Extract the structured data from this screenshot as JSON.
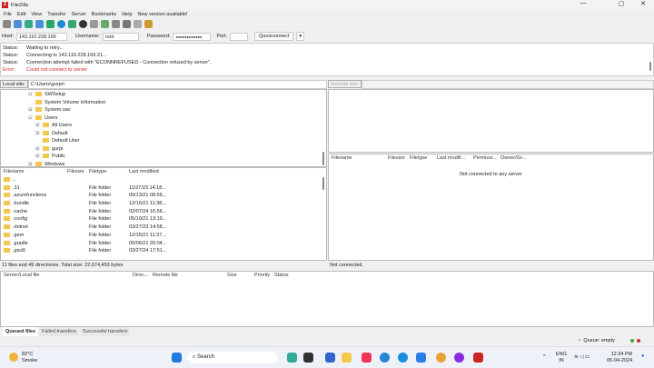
{
  "window": {
    "title": "FileZilla",
    "minimize": "—",
    "maximize": "▢",
    "close": "✕"
  },
  "menu": [
    "File",
    "Edit",
    "View",
    "Transfer",
    "Server",
    "Bookmarks",
    "Help",
    "New version available!"
  ],
  "toolbar_icons": [
    "site-manager",
    "toggle-log",
    "toggle-local-tree",
    "toggle-remote-tree",
    "toggle-queue",
    "refresh",
    "process-queue",
    "cancel",
    "disconnect",
    "reconnect",
    "directory-filter",
    "compare",
    "sync-browse",
    "find"
  ],
  "quickconnect": {
    "host_label": "Host:",
    "host": "143.110.228.169",
    "username_label": "Username:",
    "username": "root",
    "password_label": "Password:",
    "password": "●●●●●●●●●●●●",
    "port_label": "Port:",
    "port": "",
    "button": "Quickconnect",
    "dropdown": "▾"
  },
  "log": [
    {
      "k": "Status:",
      "v": "Waiting to retry...",
      "type": "status"
    },
    {
      "k": "Status:",
      "v": "Connecting to 143.110.228.169:21...",
      "type": "status"
    },
    {
      "k": "Status:",
      "v": "Connection attempt failed with \"ECONNREFUSED - Connection refused by server\".",
      "type": "status"
    },
    {
      "k": "Error:",
      "v": "Could not connect to server",
      "type": "error"
    }
  ],
  "local": {
    "site_label": "Local site:",
    "path": "C:\\Users\\gurpr\\",
    "tree": [
      {
        "name": "SWSetup",
        "indent": 1,
        "exp": "⊟"
      },
      {
        "name": "System Volume Information",
        "indent": 1,
        "exp": ""
      },
      {
        "name": "System.sav",
        "indent": 1,
        "exp": "⊞"
      },
      {
        "name": "Users",
        "indent": 1,
        "exp": "⊟"
      },
      {
        "name": "All Users",
        "indent": 2,
        "exp": "⊞"
      },
      {
        "name": "Default",
        "indent": 2,
        "exp": "⊞"
      },
      {
        "name": "Default User",
        "indent": 2,
        "exp": ""
      },
      {
        "name": "gurpr",
        "indent": 2,
        "exp": "⊞"
      },
      {
        "name": "Public",
        "indent": 2,
        "exp": "⊞"
      },
      {
        "name": "Windows",
        "indent": 1,
        "exp": "⊞"
      }
    ],
    "columns": [
      "Filename",
      "Filesize",
      "Filetype",
      "Last modified"
    ],
    "files": [
      {
        "name": "..",
        "type": "",
        "modified": ""
      },
      {
        "name": ".31",
        "type": "File folder",
        "modified": "11/27/23 14:18..."
      },
      {
        "name": ".azurefunctions",
        "type": "File folder",
        "modified": "09/13/21 08:56..."
      },
      {
        "name": ".bundle",
        "type": "File folder",
        "modified": "12/15/21 11:38..."
      },
      {
        "name": ".cache",
        "type": "File folder",
        "modified": "02/07/24 16:56..."
      },
      {
        "name": ".config",
        "type": "File folder",
        "modified": "05/10/21 13:19..."
      },
      {
        "name": ".dotnet",
        "type": "File folder",
        "modified": "03/27/23 14:58..."
      },
      {
        "name": ".gem",
        "type": "File folder",
        "modified": "12/15/21 11:37..."
      },
      {
        "name": ".gradle",
        "type": "File folder",
        "modified": "05/06/21 20:04..."
      },
      {
        "name": ".gscill",
        "type": "File folder",
        "modified": "03/27/24 17:51..."
      }
    ],
    "status": "11 files and 49 directories. Total size: 22,674,453 bytes"
  },
  "remote": {
    "site_label": "Remote site:",
    "columns": [
      "Filename",
      "Filesize",
      "Filetype",
      "Last modifi...",
      "Permissi...",
      "Owner/Gr..."
    ],
    "empty": "Not connected to any server",
    "status": "Not connected."
  },
  "queue": {
    "columns": [
      "Server/Local file",
      "Direc...",
      "Remote file",
      "Size",
      "Priority",
      "Status"
    ],
    "tabs": [
      "Queued files",
      "Failed transfers",
      "Successful transfers"
    ],
    "status": "Queue: empty"
  },
  "taskbar": {
    "weather_temp": "82°C",
    "weather_desc": "Smoke",
    "search": "Search",
    "lang1": "ENG",
    "lang2": "IN",
    "time": "12:34 PM",
    "date": "05-04-2024"
  }
}
